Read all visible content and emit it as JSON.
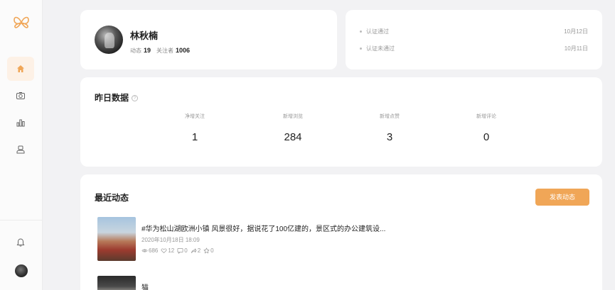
{
  "sidebar": {
    "items": [
      {
        "name": "home-icon",
        "active": true
      },
      {
        "name": "camera-icon",
        "active": false
      },
      {
        "name": "chart-icon",
        "active": false
      },
      {
        "name": "user-icon",
        "active": false
      }
    ]
  },
  "profile": {
    "name": "林秋楠",
    "posts_label": "动态",
    "posts_count": "19",
    "followers_label": "关注者",
    "followers_count": "1006"
  },
  "certifications": [
    {
      "label": "认证通过",
      "date": "10月12日"
    },
    {
      "label": "认证未通过",
      "date": "10月11日"
    }
  ],
  "stats": {
    "title": "昨日数据",
    "items": [
      {
        "label": "净增关注",
        "value": "1"
      },
      {
        "label": "新增浏览",
        "value": "284"
      },
      {
        "label": "新增点赞",
        "value": "3"
      },
      {
        "label": "新增评论",
        "value": "0"
      }
    ]
  },
  "recent": {
    "title": "最近动态",
    "publish_label": "发表动态",
    "posts": [
      {
        "title": "#华为松山湖欧洲小镇 风景很好，据说花了100亿建的，景区式的办公建筑设...",
        "date": "2020年10月18日 18:09",
        "views": "686",
        "likes": "12",
        "comments": "0",
        "shares": "2",
        "stars": "0"
      },
      {
        "title": "猫"
      }
    ]
  },
  "colors": {
    "accent": "#f0a657",
    "active_bg": "#fdf1e6"
  }
}
